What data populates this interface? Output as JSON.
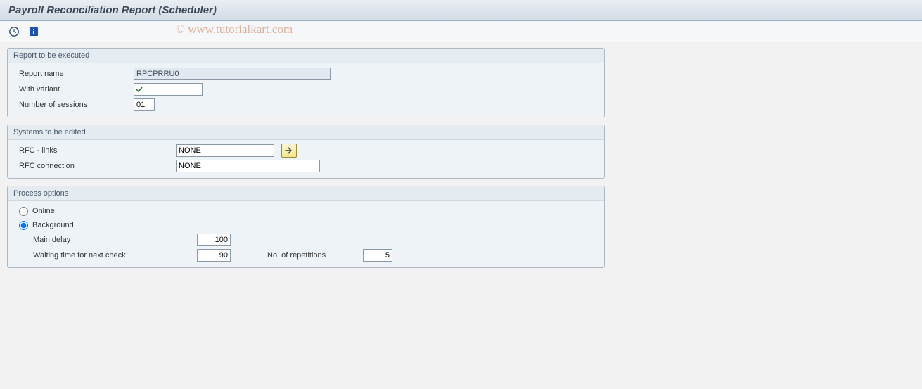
{
  "title": "Payroll Reconciliation Report (Scheduler)",
  "watermark": "© www.tutorialkart.com",
  "toolbar": {
    "execute_tip": "Execute",
    "info_tip": "Information"
  },
  "groups": {
    "report": {
      "title": "Report to be executed",
      "fields": {
        "report_name_label": "Report name",
        "report_name_value": "RPCPRRU0",
        "with_variant_label": "With variant",
        "with_variant_value": "",
        "sessions_label": "Number of sessions",
        "sessions_value": "01"
      }
    },
    "systems": {
      "title": "Systems to be edited",
      "fields": {
        "rfc_links_label": "RFC - links",
        "rfc_links_value": "NONE",
        "rfc_conn_label": "RFC connection",
        "rfc_conn_value": "NONE"
      }
    },
    "process": {
      "title": "Process options",
      "options": {
        "online_label": "Online",
        "background_label": "Background",
        "selected": "background",
        "main_delay_label": "Main delay",
        "main_delay_value": "100",
        "wait_label": "Waiting time for next check",
        "wait_value": "90",
        "reps_label": "No. of repetitions",
        "reps_value": "5"
      }
    }
  }
}
